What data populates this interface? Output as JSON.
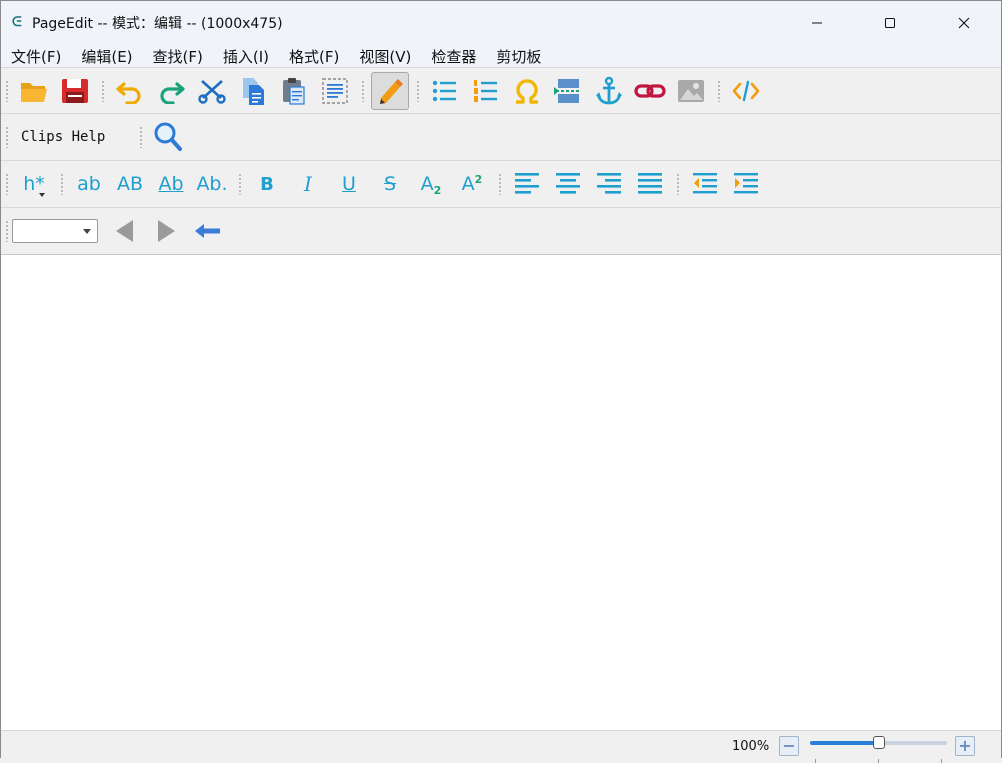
{
  "window": {
    "title": "PageEdit -- 模式：编辑 -- (1000x475)",
    "app_icon_glyph": "ᕮ",
    "controls": [
      "minimize",
      "maximize",
      "close"
    ]
  },
  "menubar": {
    "items": [
      "文件(F)",
      "编辑(E)",
      "查找(F)",
      "插入(I)",
      "格式(F)",
      "视图(V)",
      "检查器",
      "剪切板"
    ]
  },
  "toolbar_main": {
    "buttons": [
      {
        "icon": "folder-open-icon"
      },
      {
        "icon": "save-icon"
      },
      {
        "icon": "undo-icon"
      },
      {
        "icon": "redo-icon"
      },
      {
        "icon": "cut-icon"
      },
      {
        "icon": "copy-icon"
      },
      {
        "icon": "paste-icon"
      },
      {
        "icon": "select-all-icon"
      },
      {
        "icon": "pencil-edit-icon",
        "active": true
      },
      {
        "icon": "bullet-list-icon"
      },
      {
        "icon": "numbered-list-icon"
      },
      {
        "icon": "omega-special-char-icon"
      },
      {
        "icon": "page-break-icon"
      },
      {
        "icon": "anchor-icon"
      },
      {
        "icon": "link-icon"
      },
      {
        "icon": "image-icon"
      },
      {
        "icon": "code-view-icon"
      }
    ]
  },
  "toolbar_clips": {
    "label": "Clips Help"
  },
  "toolbar_format": {
    "heading_label": "h*",
    "case_buttons": [
      "ab",
      "AB",
      "Ab",
      "Ab."
    ],
    "style_buttons": [
      "B",
      "I",
      "U",
      "S",
      "A",
      "A"
    ],
    "subscript_mark": "2",
    "superscript_mark": "2"
  },
  "navbar": {
    "combo_value": ""
  },
  "statusbar": {
    "zoom_label": "100%",
    "zoom_fraction": 0.5,
    "minus": "−",
    "plus": "+"
  },
  "colors": {
    "accent_blue": "#1e9fcf",
    "orange": "#f39c12",
    "red": "#d62c2c",
    "green": "#1aa37a",
    "crimson": "#c0153f"
  }
}
